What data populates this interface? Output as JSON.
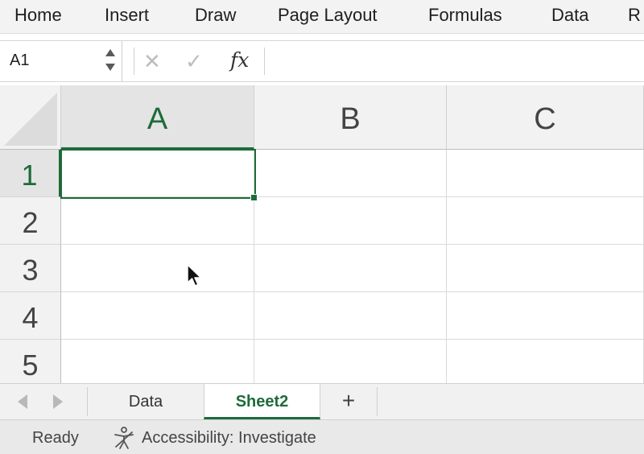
{
  "ribbon": {
    "tabs": [
      "Home",
      "Insert",
      "Draw",
      "Page Layout",
      "Formulas",
      "Data",
      "R"
    ]
  },
  "formula_bar": {
    "name_box_value": "A1",
    "cancel_symbol": "✕",
    "enter_symbol": "✓",
    "function_symbol": "fx",
    "formula_value": ""
  },
  "grid": {
    "columns": [
      "A",
      "B",
      "C"
    ],
    "rows": [
      "1",
      "2",
      "3",
      "4",
      "5"
    ],
    "selected_cell": "A1",
    "accent_color": "#1e6b3a"
  },
  "sheets": {
    "tabs": [
      "Data",
      "Sheet2"
    ],
    "active": "Sheet2",
    "add_label": "+"
  },
  "status": {
    "ready": "Ready",
    "accessibility": "Accessibility: Investigate"
  },
  "icons": [
    "up-down-stepper-icon",
    "cancel-icon",
    "enter-icon",
    "function-icon",
    "prev-sheet-icon",
    "next-sheet-icon",
    "accessibility-icon",
    "mouse-pointer-icon"
  ]
}
